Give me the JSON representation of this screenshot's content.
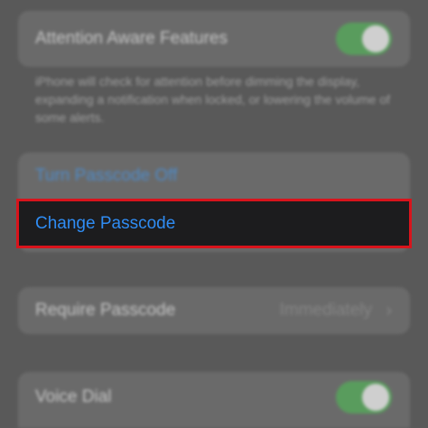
{
  "attention": {
    "label": "Attention Aware Features",
    "toggle_on": true,
    "footer": "iPhone will check for attention before dimming the display, expanding a notification when locked, or lowering the volume of some alerts."
  },
  "passcode": {
    "turn_off_label": "Turn Passcode Off",
    "change_label": "Change Passcode"
  },
  "require_passcode": {
    "label": "Require Passcode",
    "value": "Immediately",
    "chevron": "›"
  },
  "voice_dial": {
    "label": "Voice Dial",
    "toggle_on": true
  },
  "colors": {
    "highlight_border": "#d8141c",
    "link_blue": "#2f8cf3",
    "toggle_green": "#5aa25e"
  }
}
